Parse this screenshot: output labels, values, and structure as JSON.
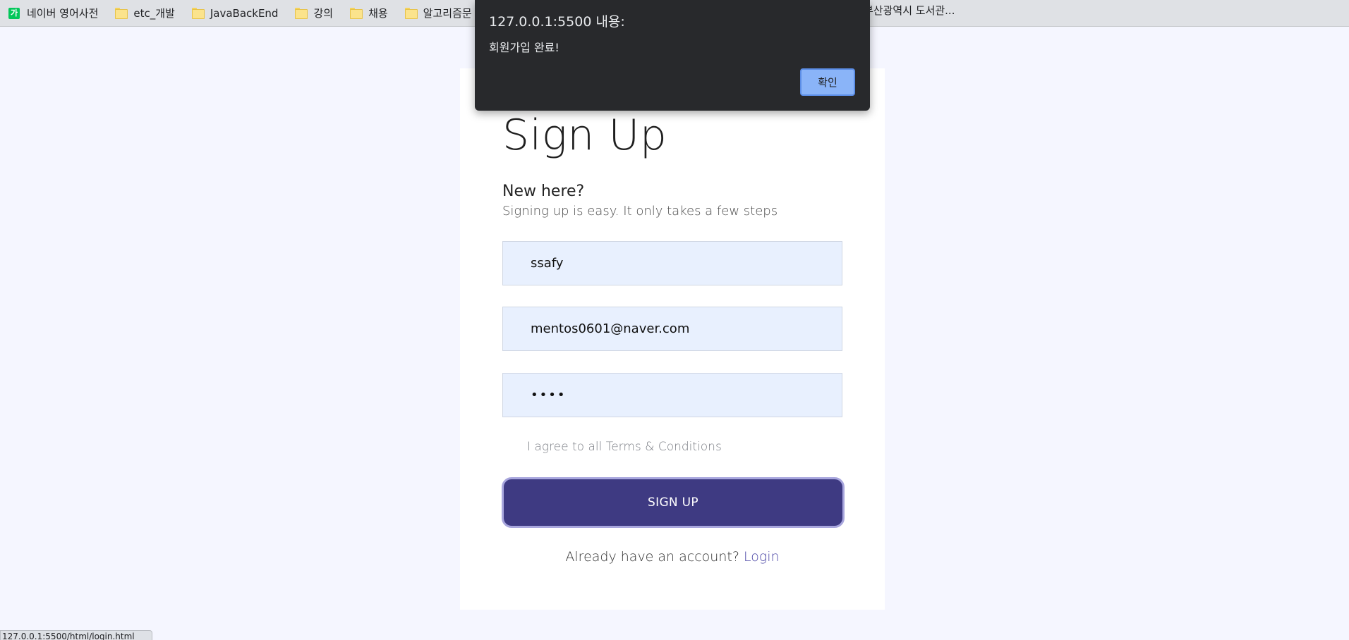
{
  "bookmarks": [
    {
      "label": "네이버 영어사전",
      "icon": "naver-favicon",
      "icon_text": "가"
    },
    {
      "label": "etc_개발",
      "icon": "folder-icon"
    },
    {
      "label": "JavaBackEnd",
      "icon": "folder-icon"
    },
    {
      "label": "강의",
      "icon": "folder-icon"
    },
    {
      "label": "채용",
      "icon": "folder-icon"
    },
    {
      "label": "알고리즘문",
      "icon": "folder-icon"
    }
  ],
  "bookmark_right_label": "부산광역시 도서관...",
  "alert": {
    "title": "127.0.0.1:5500 내용:",
    "message": "회원가입 완료!",
    "ok_label": "확인"
  },
  "signup": {
    "title": "Sign Up",
    "heading": "New here?",
    "subheading": "Signing up is easy. It only takes a few steps",
    "username_value": "ssafy",
    "email_value": "mentos0601@naver.com",
    "password_value": "••••",
    "terms_label": "I agree to all Terms & Conditions",
    "submit_label": "SIGN UP",
    "login_prompt": "Already have an account?",
    "login_link": "Login"
  },
  "status_bar_text": "127.0.0.1:5500/html/login.html",
  "colors": {
    "page_background": "#f5f6ff",
    "button_primary": "#3e3a82",
    "input_background": "#e8f0fe",
    "link": "#4c47a6",
    "alert_background": "#28292c",
    "alert_button": "#8ab4f8"
  }
}
